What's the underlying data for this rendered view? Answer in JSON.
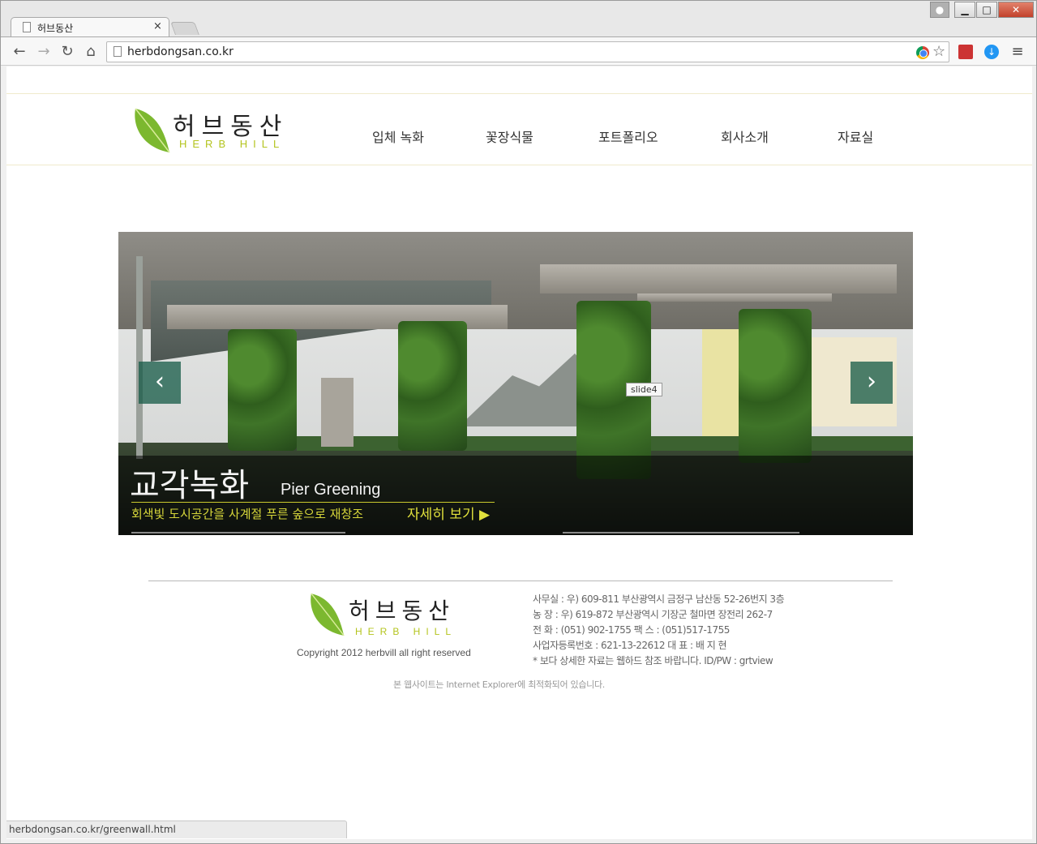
{
  "browser": {
    "tab_title": "허브동산",
    "tab_close": "×",
    "url": "herbdongsan.co.kr",
    "status_url": "herbdongsan.co.kr/greenwall.html",
    "window_buttons": {
      "minimize": "▁",
      "maximize": "□",
      "close": "✕"
    },
    "nav_icons": {
      "back": "←",
      "forward": "→",
      "reload": "↻",
      "home": "⌂"
    },
    "toolbar_icons": {
      "star": "☆",
      "download": "↓",
      "menu": "≡"
    }
  },
  "colors": {
    "brand_green": "#b4c41e",
    "caption_text": "#d6d63a",
    "arrow_bg": "#145a46"
  },
  "header": {
    "logo": {
      "name_ko": "허브동산",
      "name_en": "HERB HILL"
    },
    "nav": [
      {
        "label": "입체 녹화"
      },
      {
        "label": "꽃장식물"
      },
      {
        "label": "포트폴리오"
      },
      {
        "label": "회사소개"
      },
      {
        "label": "자료실"
      }
    ]
  },
  "slider": {
    "prev_label": "‹",
    "next_label": "›",
    "tooltip": "slide4",
    "caption": {
      "title_ko": "교각녹화",
      "title_en": "Pier Greening",
      "description": "회색빛 도시공간을 사계절 푸른 숲으로 재창조",
      "more_label": "자세히 보기 ▶"
    }
  },
  "footer": {
    "logo": {
      "name_ko": "허브동산",
      "name_en": "HERB HILL"
    },
    "copyright": "Copyright 2012 herbvill  all right reserved",
    "info": [
      "사무실 : 우) 609-811  부산광역시 금정구 남산동 52-26번지 3층",
      "농    장 : 우) 619-872  부산광역시 기장군 철마면 장전리 262-7",
      "전    화 : (051) 902-1755        팩    스 : (051)517-1755",
      "사업자등록번호 : 621-13-22612       대  표 : 배 지 현",
      "* 보다 상세한 자료는 웹하드 참조 바랍니다.   ID/PW : grtview"
    ],
    "notice": "본 웹사이트는 Internet Explorer에 최적화되어 있습니다."
  }
}
